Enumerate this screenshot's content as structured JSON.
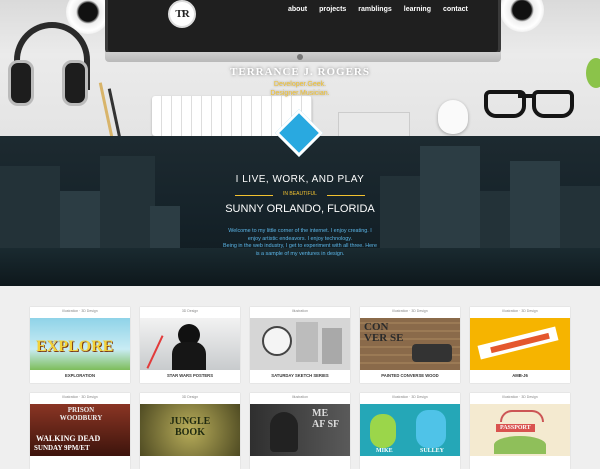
{
  "header": {
    "logo": "TR",
    "nav": [
      "about",
      "projects",
      "ramblings",
      "learning",
      "contact"
    ]
  },
  "hero": {
    "name": "TERRANCE J. ROGERS",
    "tagline1": "Developer.Geek.",
    "tagline2": "Designer.Musician."
  },
  "about": {
    "headline": "I LIVE, WORK, AND PLAY",
    "in_beautiful": "IN BEAUTIFUL",
    "location": "SUNNY ORLANDO, FLORIDA",
    "intro": [
      "Welcome to my little corner of the internet. I enjoy creating. I",
      "enjoy artistic endeavors. I enjoy technology.",
      "Being in the web industry, I get to experiment with all three. Here",
      "is a sample of my ventures in design."
    ]
  },
  "projects": [
    {
      "category": "Illustration · 3D Design",
      "title": "EXPLORATION",
      "bg": "#8fd3e8"
    },
    {
      "category": "3D Design",
      "title": "STAR WARS POSTERS",
      "bg": "#dfe2e4"
    },
    {
      "category": "Illustration",
      "title": "SATURDAY SKETCH SERIES",
      "bg": "#cfcfcf"
    },
    {
      "category": "Illustration · 3D Design",
      "title": "PAINTED CONVERSE WOOD",
      "bg": "#8a6a4a"
    },
    {
      "category": "Illustration · 3D Design",
      "title": "AMB-J6",
      "bg": "#f6b400"
    },
    {
      "category": "Illustration · 3D Design",
      "title": "",
      "bg": "#6e2a1e"
    },
    {
      "category": "3D Design",
      "title": "",
      "bg": "#6f6d3a"
    },
    {
      "category": "Illustration",
      "title": "",
      "bg": "#3a3a3a"
    },
    {
      "category": "Illustration · 3D Design",
      "title": "",
      "bg": "#25a7b7"
    },
    {
      "category": "Illustration · 3D Design",
      "title": "",
      "bg": "#f4ead0"
    }
  ],
  "thumb_text": {
    "exploration": "EXPLORE",
    "converse": "CON VER SE",
    "walking_dead_top": "PRISON WOODBURY",
    "walking_dead": "WALKING DEAD",
    "walking_dead_time": "SUNDAY 9PM/ET",
    "jungle": "JUNGLE BOOK",
    "mass_effect": "ME AF SF",
    "mike": "MIKE",
    "sulley": "SULLEY",
    "passport": "PASSPORT"
  },
  "colors": {
    "accent": "#29a9e0",
    "gold": "#f2c230"
  }
}
